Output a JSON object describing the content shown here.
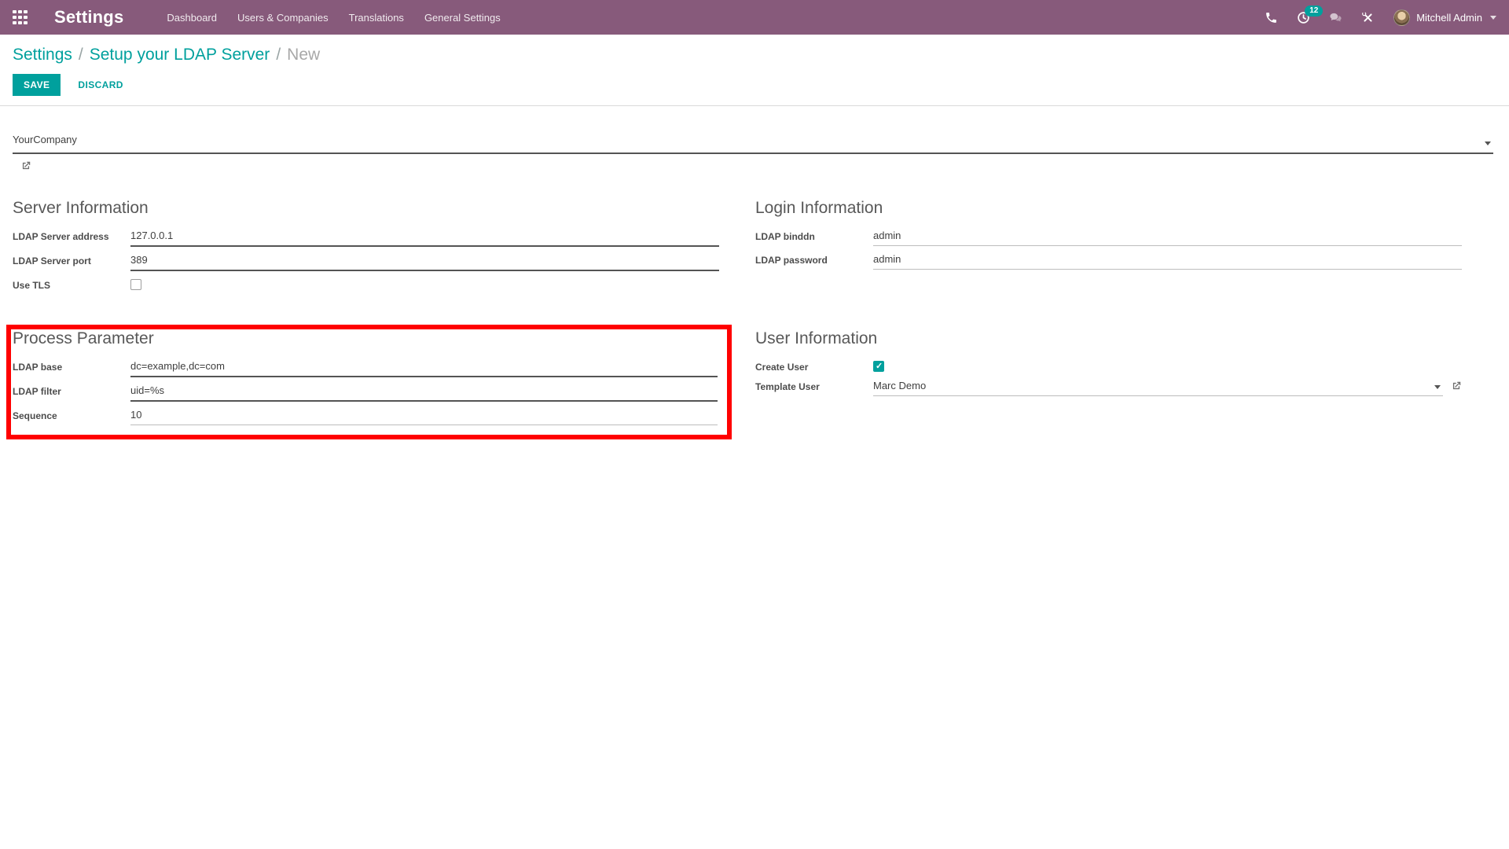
{
  "navbar": {
    "app_title": "Settings",
    "menu_items": [
      "Dashboard",
      "Users & Companies",
      "Translations",
      "General Settings"
    ],
    "activities_badge": "12",
    "user_name": "Mitchell Admin",
    "icons": {
      "apps": "grid-icon",
      "phone": "phone-icon",
      "activities": "clock-icon",
      "messages": "chat-bubbles-icon",
      "tools": "crossed-tools-icon"
    },
    "colors": {
      "navbar_bg": "#875A7B",
      "badge_bg": "#00A09D"
    }
  },
  "breadcrumb": {
    "items": [
      "Settings",
      "Setup your LDAP Server"
    ],
    "current": "New",
    "separator": "/"
  },
  "actions": {
    "save": "SAVE",
    "discard": "DISCARD"
  },
  "form": {
    "company": {
      "value": "YourCompany",
      "icons": [
        "dropdown-caret",
        "external-link-icon"
      ]
    },
    "server_information": {
      "title": "Server Information",
      "ldap_server_address": {
        "label": "LDAP Server address",
        "value": "127.0.0.1"
      },
      "ldap_server_port": {
        "label": "LDAP Server port",
        "value": "389"
      },
      "use_tls": {
        "label": "Use TLS",
        "checked": false
      }
    },
    "login_information": {
      "title": "Login Information",
      "ldap_binddn": {
        "label": "LDAP binddn",
        "value": "admin"
      },
      "ldap_password": {
        "label": "LDAP password",
        "value": "admin"
      }
    },
    "process_parameter": {
      "title": "Process Parameter",
      "ldap_base": {
        "label": "LDAP base",
        "value": "dc=example,dc=com"
      },
      "ldap_filter": {
        "label": "LDAP filter",
        "value": "uid=%s"
      },
      "sequence": {
        "label": "Sequence",
        "value": "10"
      }
    },
    "user_information": {
      "title": "User Information",
      "create_user": {
        "label": "Create User",
        "checked": true
      },
      "template_user": {
        "label": "Template User",
        "value": "Marc Demo",
        "icons": [
          "dropdown-caret",
          "external-link-icon"
        ]
      }
    }
  },
  "annotation": {
    "type": "highlight-box",
    "target": "process-parameter-section",
    "color": "#FF0000"
  },
  "colors": {
    "accent": "#00A09D",
    "required_underline": "#545454",
    "optional_underline": "#BDBDBD"
  }
}
